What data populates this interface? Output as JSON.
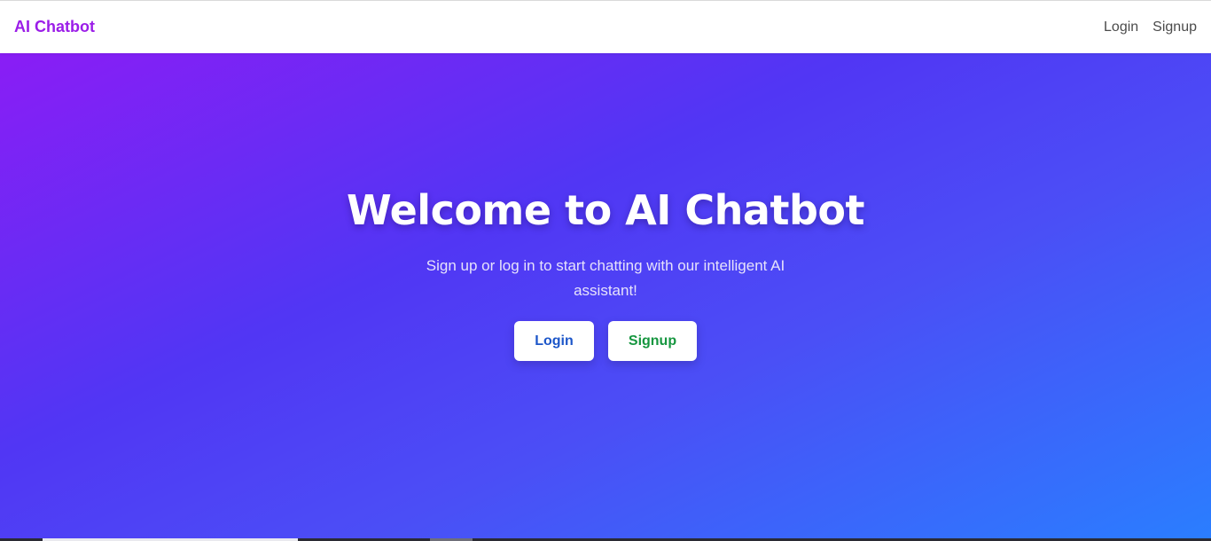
{
  "navbar": {
    "brand": "AI Chatbot",
    "links": [
      "Login",
      "Signup"
    ]
  },
  "hero": {
    "title": "Welcome to AI Chatbot",
    "subtitle": "Sign up or log in to start chatting with our intelligent AI assistant!",
    "buttons": {
      "login": "Login",
      "signup": "Signup"
    }
  },
  "colors": {
    "brand": "#9b1de8",
    "gradient_start": "#8a1df5",
    "gradient_mid": "#5136f4",
    "gradient_end": "#2a7eff",
    "login_button_text": "#1c56c9",
    "signup_button_text": "#15963f"
  }
}
